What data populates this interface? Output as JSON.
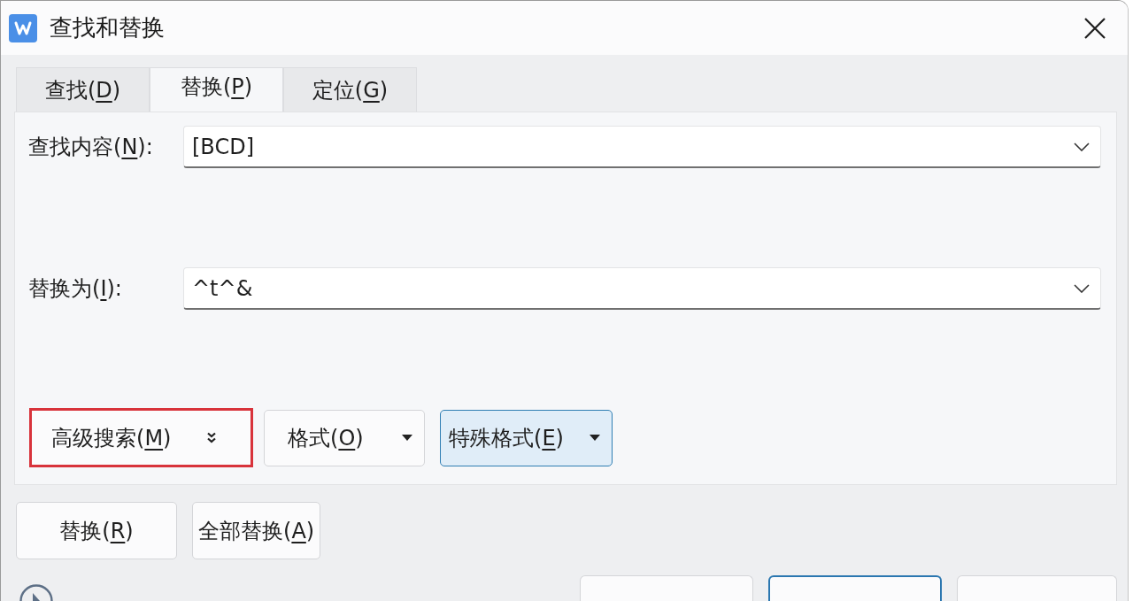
{
  "window": {
    "title": "查找和替换"
  },
  "tabs": [
    {
      "label": {
        "before": "查找(",
        "key": "D",
        "after": ")"
      },
      "selected": false
    },
    {
      "label": {
        "before": "替换(",
        "key": "P",
        "after": ")"
      },
      "selected": true
    },
    {
      "label": {
        "before": "定位(",
        "key": "G",
        "after": ")"
      },
      "selected": false
    }
  ],
  "find_what": {
    "label": {
      "before": "查找内容(",
      "key": "N",
      "after": "):"
    },
    "value": "[BCD]"
  },
  "replace_with": {
    "label": {
      "before": "替换为(",
      "key": "I",
      "after": "):"
    },
    "value": "^t^&"
  },
  "option_buttons": [
    {
      "label": {
        "before": "高级搜索(",
        "key": "M",
        "after": ")"
      },
      "kind": "expander",
      "highlighted": true,
      "focused": false
    },
    {
      "label": {
        "before": "格式(",
        "key": "O",
        "after": ")"
      },
      "kind": "dropdown",
      "highlighted": false,
      "focused": false
    },
    {
      "label": {
        "before": "特殊格式(",
        "key": "E",
        "after": ")"
      },
      "kind": "dropdown",
      "highlighted": false,
      "focused": true
    }
  ],
  "action_buttons": [
    {
      "label": {
        "before": "替换(",
        "key": "R",
        "after": ")"
      }
    },
    {
      "label": {
        "before": "全部替换(",
        "key": "A",
        "after": ")"
      }
    }
  ],
  "footer_buttons": [
    {
      "default": false
    },
    {
      "default": true
    },
    {
      "default": false
    }
  ]
}
